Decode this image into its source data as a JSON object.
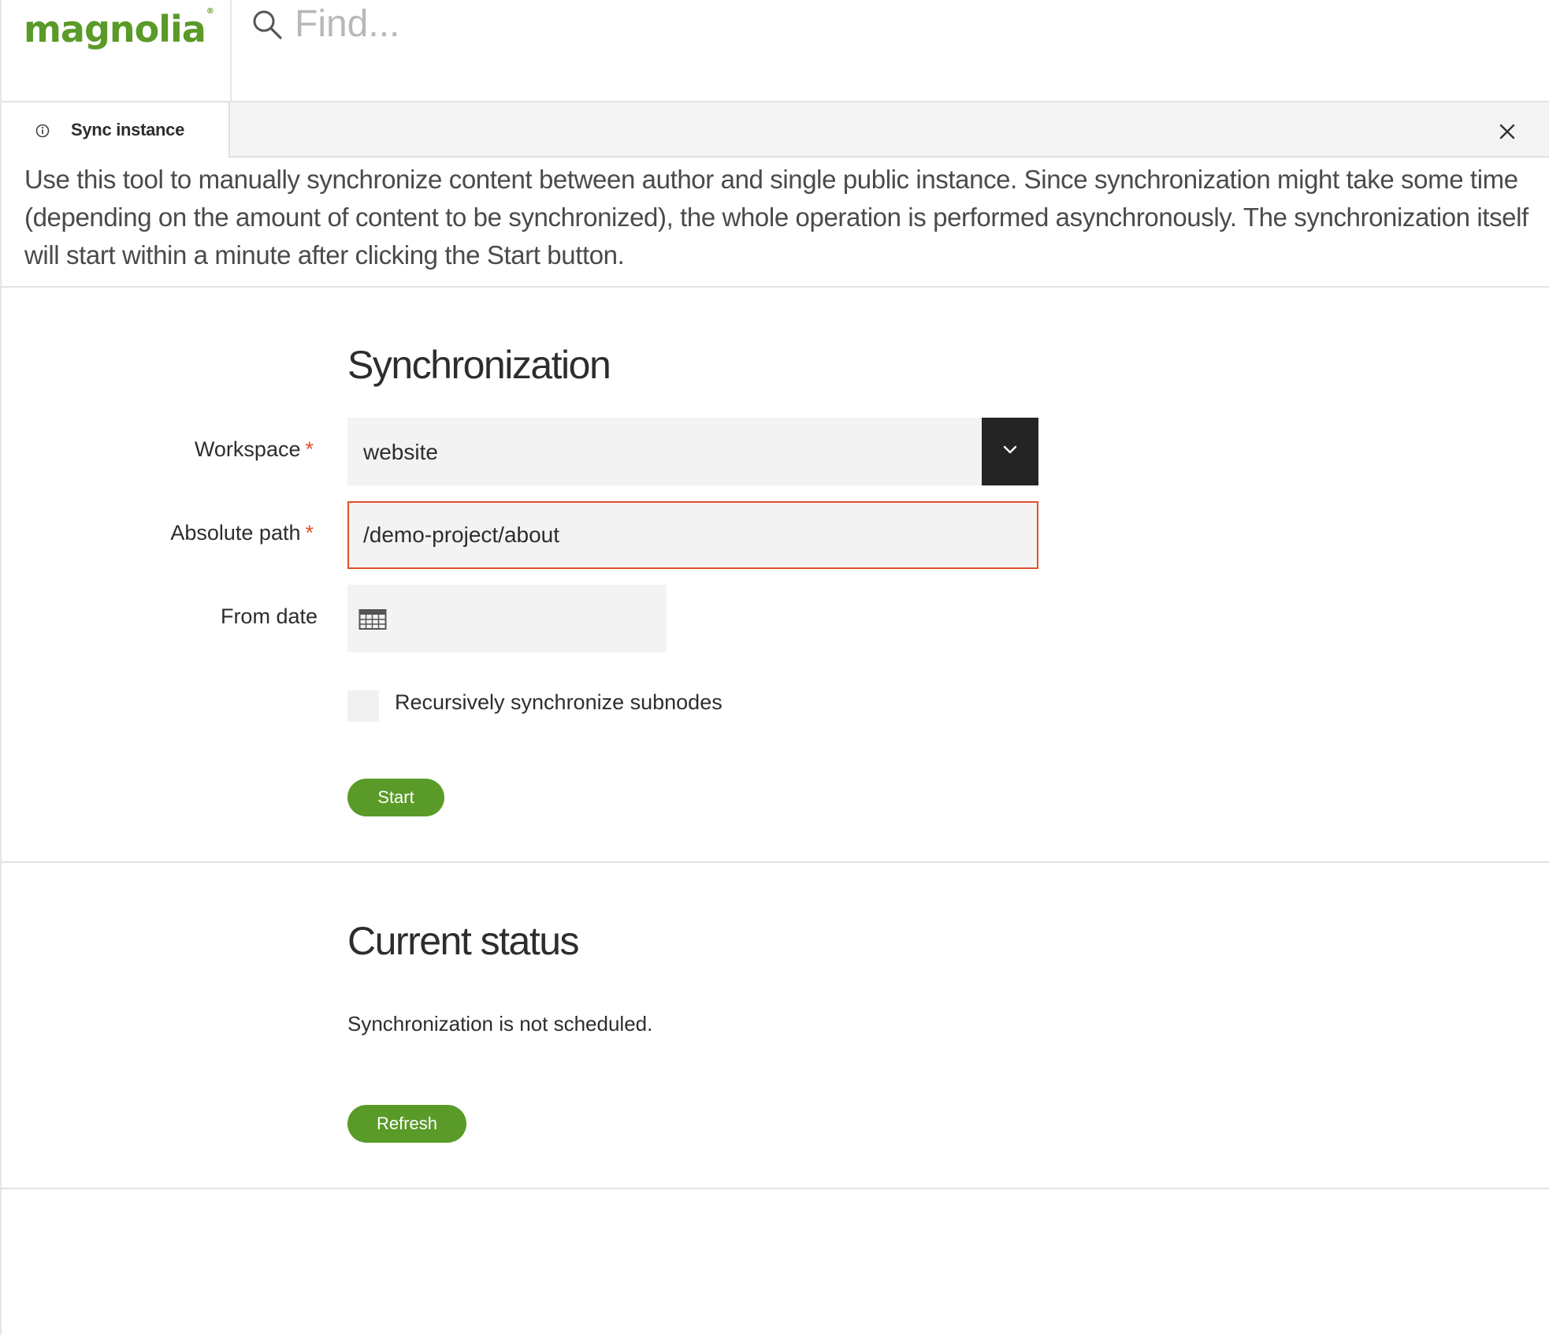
{
  "header": {
    "logo_text": "magnolia",
    "logo_mark": "®",
    "search_placeholder": "Find..."
  },
  "tabs": [
    {
      "label": "Sync instance",
      "icon": "info-icon"
    }
  ],
  "description": "Use this tool to manually synchronize content between author and single public instance. Since synchronization might take some time (depending on the amount of content to be synchronized), the whole operation is performed asynchronously. The synchronization itself will start within a minute after clicking the Start button.",
  "form": {
    "title": "Synchronization",
    "workspace": {
      "label": "Workspace",
      "required_mark": "*",
      "value": "website"
    },
    "path": {
      "label": "Absolute path",
      "required_mark": "*",
      "value": "/demo-project/about"
    },
    "from_date": {
      "label": "From date",
      "value": ""
    },
    "recursive": {
      "label": "Recursively synchronize subnodes",
      "checked": false
    },
    "start_label": "Start"
  },
  "status": {
    "title": "Current status",
    "text": "Synchronization is not scheduled.",
    "refresh_label": "Refresh"
  },
  "colors": {
    "brand_green": "#5a9a28",
    "error_border": "#e2512d",
    "dropdown_dark": "#242424"
  }
}
